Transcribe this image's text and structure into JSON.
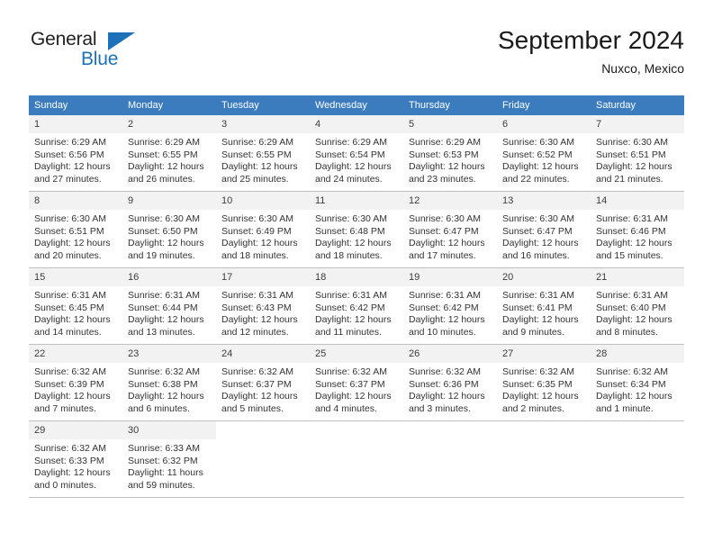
{
  "logo": {
    "word_top": "General",
    "word_bottom": "Blue",
    "triangle_color": "#1d71b8"
  },
  "header": {
    "title": "September 2024",
    "subtitle": "Nuxco, Mexico"
  },
  "theme": {
    "header_bg": "#3a7cbe",
    "header_text": "#ffffff",
    "daynum_bg": "#f2f2f2",
    "row_border": "#bfbfbf"
  },
  "weekday_headers": [
    "Sunday",
    "Monday",
    "Tuesday",
    "Wednesday",
    "Thursday",
    "Friday",
    "Saturday"
  ],
  "weeks": [
    [
      {
        "day": "1",
        "sunrise": "Sunrise: 6:29 AM",
        "sunset": "Sunset: 6:56 PM",
        "daylight_1": "Daylight: 12 hours",
        "daylight_2": "and 27 minutes."
      },
      {
        "day": "2",
        "sunrise": "Sunrise: 6:29 AM",
        "sunset": "Sunset: 6:55 PM",
        "daylight_1": "Daylight: 12 hours",
        "daylight_2": "and 26 minutes."
      },
      {
        "day": "3",
        "sunrise": "Sunrise: 6:29 AM",
        "sunset": "Sunset: 6:55 PM",
        "daylight_1": "Daylight: 12 hours",
        "daylight_2": "and 25 minutes."
      },
      {
        "day": "4",
        "sunrise": "Sunrise: 6:29 AM",
        "sunset": "Sunset: 6:54 PM",
        "daylight_1": "Daylight: 12 hours",
        "daylight_2": "and 24 minutes."
      },
      {
        "day": "5",
        "sunrise": "Sunrise: 6:29 AM",
        "sunset": "Sunset: 6:53 PM",
        "daylight_1": "Daylight: 12 hours",
        "daylight_2": "and 23 minutes."
      },
      {
        "day": "6",
        "sunrise": "Sunrise: 6:30 AM",
        "sunset": "Sunset: 6:52 PM",
        "daylight_1": "Daylight: 12 hours",
        "daylight_2": "and 22 minutes."
      },
      {
        "day": "7",
        "sunrise": "Sunrise: 6:30 AM",
        "sunset": "Sunset: 6:51 PM",
        "daylight_1": "Daylight: 12 hours",
        "daylight_2": "and 21 minutes."
      }
    ],
    [
      {
        "day": "8",
        "sunrise": "Sunrise: 6:30 AM",
        "sunset": "Sunset: 6:51 PM",
        "daylight_1": "Daylight: 12 hours",
        "daylight_2": "and 20 minutes."
      },
      {
        "day": "9",
        "sunrise": "Sunrise: 6:30 AM",
        "sunset": "Sunset: 6:50 PM",
        "daylight_1": "Daylight: 12 hours",
        "daylight_2": "and 19 minutes."
      },
      {
        "day": "10",
        "sunrise": "Sunrise: 6:30 AM",
        "sunset": "Sunset: 6:49 PM",
        "daylight_1": "Daylight: 12 hours",
        "daylight_2": "and 18 minutes."
      },
      {
        "day": "11",
        "sunrise": "Sunrise: 6:30 AM",
        "sunset": "Sunset: 6:48 PM",
        "daylight_1": "Daylight: 12 hours",
        "daylight_2": "and 18 minutes."
      },
      {
        "day": "12",
        "sunrise": "Sunrise: 6:30 AM",
        "sunset": "Sunset: 6:47 PM",
        "daylight_1": "Daylight: 12 hours",
        "daylight_2": "and 17 minutes."
      },
      {
        "day": "13",
        "sunrise": "Sunrise: 6:30 AM",
        "sunset": "Sunset: 6:47 PM",
        "daylight_1": "Daylight: 12 hours",
        "daylight_2": "and 16 minutes."
      },
      {
        "day": "14",
        "sunrise": "Sunrise: 6:31 AM",
        "sunset": "Sunset: 6:46 PM",
        "daylight_1": "Daylight: 12 hours",
        "daylight_2": "and 15 minutes."
      }
    ],
    [
      {
        "day": "15",
        "sunrise": "Sunrise: 6:31 AM",
        "sunset": "Sunset: 6:45 PM",
        "daylight_1": "Daylight: 12 hours",
        "daylight_2": "and 14 minutes."
      },
      {
        "day": "16",
        "sunrise": "Sunrise: 6:31 AM",
        "sunset": "Sunset: 6:44 PM",
        "daylight_1": "Daylight: 12 hours",
        "daylight_2": "and 13 minutes."
      },
      {
        "day": "17",
        "sunrise": "Sunrise: 6:31 AM",
        "sunset": "Sunset: 6:43 PM",
        "daylight_1": "Daylight: 12 hours",
        "daylight_2": "and 12 minutes."
      },
      {
        "day": "18",
        "sunrise": "Sunrise: 6:31 AM",
        "sunset": "Sunset: 6:42 PM",
        "daylight_1": "Daylight: 12 hours",
        "daylight_2": "and 11 minutes."
      },
      {
        "day": "19",
        "sunrise": "Sunrise: 6:31 AM",
        "sunset": "Sunset: 6:42 PM",
        "daylight_1": "Daylight: 12 hours",
        "daylight_2": "and 10 minutes."
      },
      {
        "day": "20",
        "sunrise": "Sunrise: 6:31 AM",
        "sunset": "Sunset: 6:41 PM",
        "daylight_1": "Daylight: 12 hours",
        "daylight_2": "and 9 minutes."
      },
      {
        "day": "21",
        "sunrise": "Sunrise: 6:31 AM",
        "sunset": "Sunset: 6:40 PM",
        "daylight_1": "Daylight: 12 hours",
        "daylight_2": "and 8 minutes."
      }
    ],
    [
      {
        "day": "22",
        "sunrise": "Sunrise: 6:32 AM",
        "sunset": "Sunset: 6:39 PM",
        "daylight_1": "Daylight: 12 hours",
        "daylight_2": "and 7 minutes."
      },
      {
        "day": "23",
        "sunrise": "Sunrise: 6:32 AM",
        "sunset": "Sunset: 6:38 PM",
        "daylight_1": "Daylight: 12 hours",
        "daylight_2": "and 6 minutes."
      },
      {
        "day": "24",
        "sunrise": "Sunrise: 6:32 AM",
        "sunset": "Sunset: 6:37 PM",
        "daylight_1": "Daylight: 12 hours",
        "daylight_2": "and 5 minutes."
      },
      {
        "day": "25",
        "sunrise": "Sunrise: 6:32 AM",
        "sunset": "Sunset: 6:37 PM",
        "daylight_1": "Daylight: 12 hours",
        "daylight_2": "and 4 minutes."
      },
      {
        "day": "26",
        "sunrise": "Sunrise: 6:32 AM",
        "sunset": "Sunset: 6:36 PM",
        "daylight_1": "Daylight: 12 hours",
        "daylight_2": "and 3 minutes."
      },
      {
        "day": "27",
        "sunrise": "Sunrise: 6:32 AM",
        "sunset": "Sunset: 6:35 PM",
        "daylight_1": "Daylight: 12 hours",
        "daylight_2": "and 2 minutes."
      },
      {
        "day": "28",
        "sunrise": "Sunrise: 6:32 AM",
        "sunset": "Sunset: 6:34 PM",
        "daylight_1": "Daylight: 12 hours",
        "daylight_2": "and 1 minute."
      }
    ],
    [
      {
        "day": "29",
        "sunrise": "Sunrise: 6:32 AM",
        "sunset": "Sunset: 6:33 PM",
        "daylight_1": "Daylight: 12 hours",
        "daylight_2": "and 0 minutes."
      },
      {
        "day": "30",
        "sunrise": "Sunrise: 6:33 AM",
        "sunset": "Sunset: 6:32 PM",
        "daylight_1": "Daylight: 11 hours",
        "daylight_2": "and 59 minutes."
      },
      {
        "day": "",
        "sunrise": "",
        "sunset": "",
        "daylight_1": "",
        "daylight_2": ""
      },
      {
        "day": "",
        "sunrise": "",
        "sunset": "",
        "daylight_1": "",
        "daylight_2": ""
      },
      {
        "day": "",
        "sunrise": "",
        "sunset": "",
        "daylight_1": "",
        "daylight_2": ""
      },
      {
        "day": "",
        "sunrise": "",
        "sunset": "",
        "daylight_1": "",
        "daylight_2": ""
      },
      {
        "day": "",
        "sunrise": "",
        "sunset": "",
        "daylight_1": "",
        "daylight_2": ""
      }
    ]
  ]
}
